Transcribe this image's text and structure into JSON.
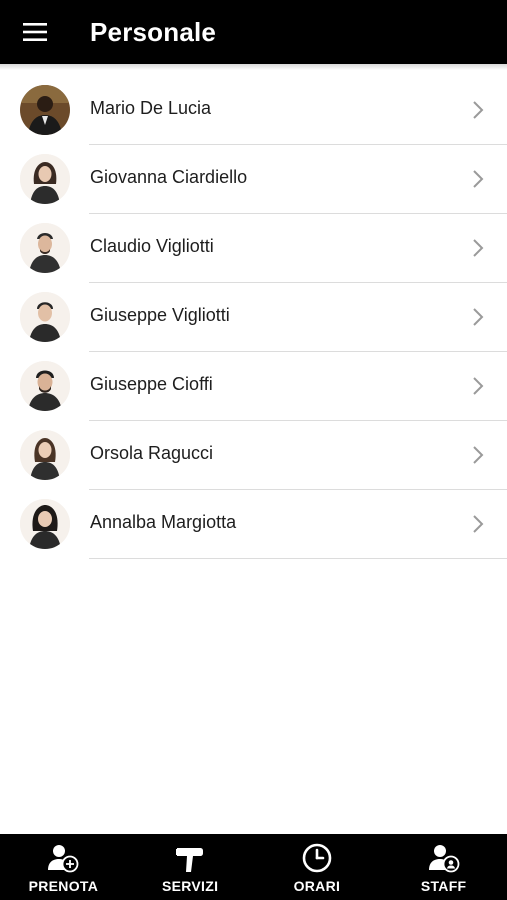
{
  "header": {
    "title": "Personale",
    "menu_icon": "menu-icon"
  },
  "staff": [
    {
      "name": "Mario De Lucia",
      "avatar": "man-suit-avatar"
    },
    {
      "name": "Giovanna Ciardiello",
      "avatar": "woman-avatar"
    },
    {
      "name": "Claudio Vigliotti",
      "avatar": "man-avatar"
    },
    {
      "name": "Giuseppe Vigliotti",
      "avatar": "man-avatar"
    },
    {
      "name": "Giuseppe Cioffi",
      "avatar": "man-avatar"
    },
    {
      "name": "Orsola Ragucci",
      "avatar": "woman-avatar"
    },
    {
      "name": "Annalba Margiotta",
      "avatar": "woman-avatar"
    }
  ],
  "bottom_nav": [
    {
      "label": "PRENOTA",
      "icon": "person-add-icon"
    },
    {
      "label": "SERVIZI",
      "icon": "hair-dryer-icon"
    },
    {
      "label": "ORARI",
      "icon": "clock-icon"
    },
    {
      "label": "STAFF",
      "icon": "staff-icon"
    }
  ],
  "colors": {
    "bar_background": "#000000",
    "bar_text": "#ffffff",
    "list_text": "#1e1e1e",
    "divider": "#dcdcdc",
    "chevron": "#9a9a9a"
  }
}
